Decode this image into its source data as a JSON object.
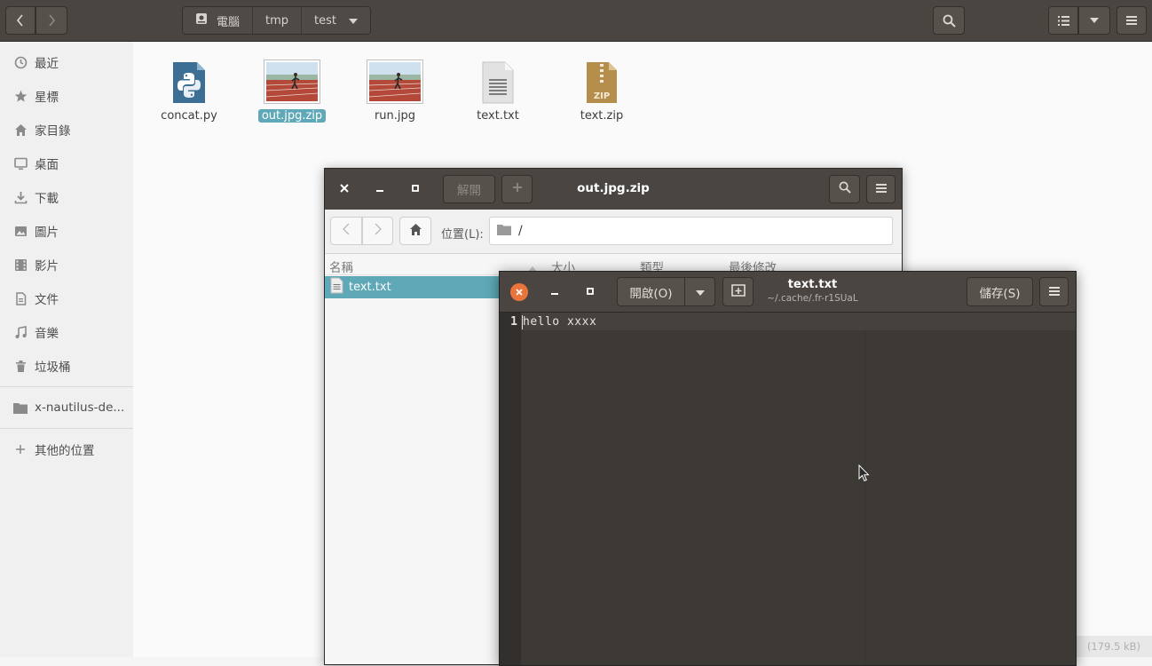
{
  "nautilus": {
    "breadcrumbs": [
      {
        "label": "電腦"
      },
      {
        "label": "tmp"
      },
      {
        "label": "test"
      }
    ]
  },
  "sidebar": {
    "items": [
      {
        "label": "最近",
        "icon": "clock-icon"
      },
      {
        "label": "星標",
        "icon": "star-icon"
      },
      {
        "label": "家目錄",
        "icon": "home-icon"
      },
      {
        "label": "桌面",
        "icon": "desktop-icon"
      },
      {
        "label": "下載",
        "icon": "download-icon"
      },
      {
        "label": "圖片",
        "icon": "picture-icon"
      },
      {
        "label": "影片",
        "icon": "video-icon"
      },
      {
        "label": "文件",
        "icon": "document-icon"
      },
      {
        "label": "音樂",
        "icon": "music-icon"
      },
      {
        "label": "垃圾桶",
        "icon": "trash-icon"
      }
    ],
    "mount": {
      "label": "x-nautilus-de...",
      "icon": "folder-icon"
    },
    "other": {
      "label": "其他的位置",
      "icon": "plus-icon"
    }
  },
  "files": [
    {
      "name": "concat.py",
      "type": "python"
    },
    {
      "name": "out.jpg.zip",
      "type": "image",
      "selected": true
    },
    {
      "name": "run.jpg",
      "type": "image"
    },
    {
      "name": "text.txt",
      "type": "text"
    },
    {
      "name": "text.zip",
      "type": "zip"
    }
  ],
  "status": "(179.5 kB)",
  "archive": {
    "title": "out.jpg.zip",
    "extract_label": "解開",
    "add_label": "+",
    "location_label": "位置(L):",
    "location_value": "/",
    "columns": {
      "name": "名稱",
      "size": "大小",
      "type": "類型",
      "modified": "最後修改"
    },
    "rows": [
      {
        "name": "text.txt"
      }
    ]
  },
  "editor": {
    "title": "text.txt",
    "subtitle": "~/.cache/.fr-r1SUaL",
    "open_label": "開啟(O)",
    "save_label": "儲存(S)",
    "line_number": "1",
    "content": "hello xxxx"
  },
  "colors": {
    "header_bg": "#4a4541",
    "selection": "#5fa8b8",
    "editor_bg": "#3d3935",
    "close_orange": "#e9753b"
  }
}
